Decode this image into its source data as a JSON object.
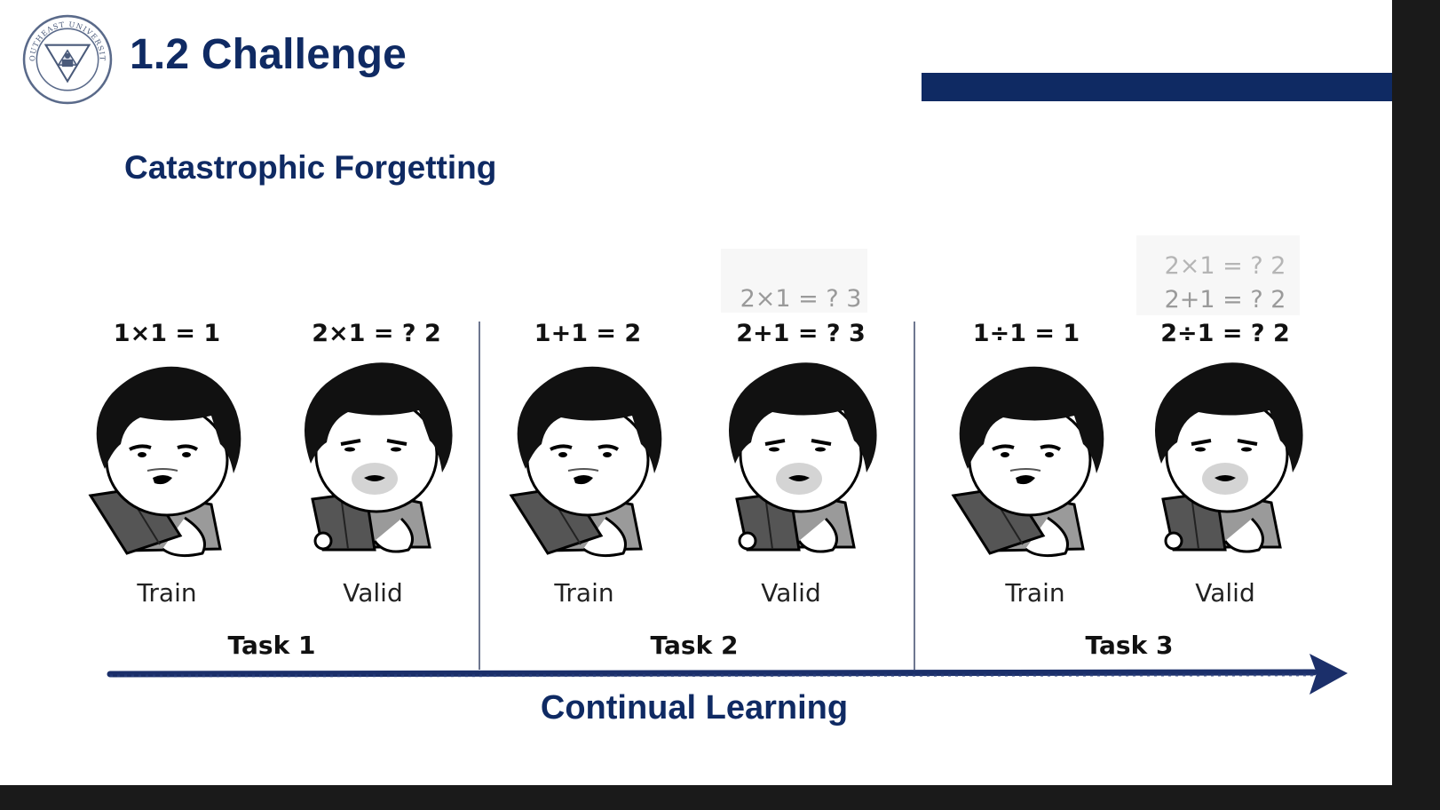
{
  "header": {
    "title": "1.2 Challenge",
    "logo_name": "Southeast University seal",
    "logo_text": "SOUTHEAST UNIVERSITY",
    "accent_color": "#0f2a63"
  },
  "subtitle": "Catastrophic Forgetting",
  "tasks": [
    {
      "label": "Task 1",
      "train": {
        "equation": "1×1 = 1",
        "label": "Train"
      },
      "valid": {
        "equations": [
          "2×1 = ?  2"
        ],
        "label": "Valid"
      }
    },
    {
      "label": "Task 2",
      "train": {
        "equation": "1+1 = 2",
        "label": "Train"
      },
      "valid": {
        "equations": [
          "2×1 = ?  3",
          "2+1 = ?  3"
        ],
        "label": "Valid"
      }
    },
    {
      "label": "Task 3",
      "train": {
        "equation": "1÷1 = 1",
        "label": "Train"
      },
      "valid": {
        "equations": [
          "2×1 = ?  2",
          "2+1 = ?  2",
          "2÷1 = ?  2"
        ],
        "label": "Valid"
      }
    }
  ],
  "timeline": {
    "label": "Continual Learning",
    "arrow_icon": "arrow-right-icon"
  }
}
